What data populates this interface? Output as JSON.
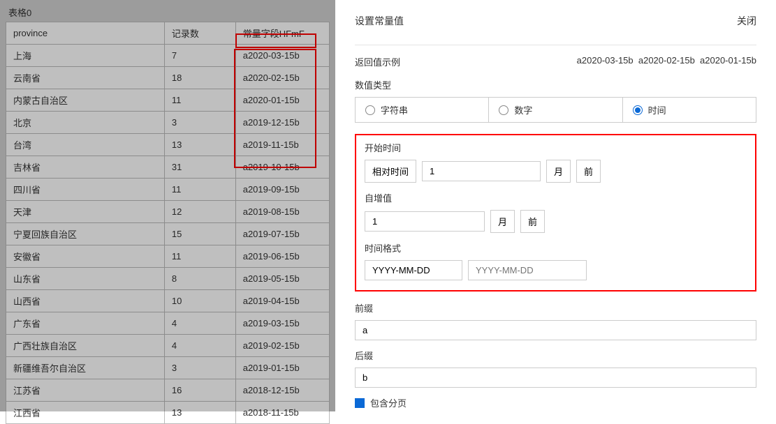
{
  "left": {
    "title": "表格0",
    "headers": [
      "province",
      "记录数",
      "常量字段HFmF"
    ],
    "rows": [
      {
        "c0": "上海",
        "c1": "7",
        "c2": "a2020-03-15b"
      },
      {
        "c0": "云南省",
        "c1": "18",
        "c2": "a2020-02-15b"
      },
      {
        "c0": "内蒙古自治区",
        "c1": "11",
        "c2": "a2020-01-15b"
      },
      {
        "c0": "北京",
        "c1": "3",
        "c2": "a2019-12-15b"
      },
      {
        "c0": "台湾",
        "c1": "13",
        "c2": "a2019-11-15b"
      },
      {
        "c0": "吉林省",
        "c1": "31",
        "c2": "a2019-10-15b"
      },
      {
        "c0": "四川省",
        "c1": "11",
        "c2": "a2019-09-15b"
      },
      {
        "c0": "天津",
        "c1": "12",
        "c2": "a2019-08-15b"
      },
      {
        "c0": "宁夏回族自治区",
        "c1": "15",
        "c2": "a2019-07-15b"
      },
      {
        "c0": "安徽省",
        "c1": "11",
        "c2": "a2019-06-15b"
      },
      {
        "c0": "山东省",
        "c1": "8",
        "c2": "a2019-05-15b"
      },
      {
        "c0": "山西省",
        "c1": "10",
        "c2": "a2019-04-15b"
      },
      {
        "c0": "广东省",
        "c1": "4",
        "c2": "a2019-03-15b"
      },
      {
        "c0": "广西壮族自治区",
        "c1": "4",
        "c2": "a2019-02-15b"
      },
      {
        "c0": "新疆维吾尔自治区",
        "c1": "3",
        "c2": "a2019-01-15b"
      },
      {
        "c0": "江苏省",
        "c1": "16",
        "c2": "a2018-12-15b"
      },
      {
        "c0": "江西省",
        "c1": "13",
        "c2": "a2018-11-15b"
      }
    ]
  },
  "right": {
    "title": "设置常量值",
    "close": "关闭",
    "example_label": "返回值示例",
    "example_value": "a2020-03-15b  a2020-02-15b  a2020-01-15b",
    "type_label": "数值类型",
    "type_options": {
      "string": "字符串",
      "number": "数字",
      "time": "时间"
    },
    "start_label": "开始时间",
    "relative_time_btn": "相对时间",
    "start_value": "1",
    "unit_month": "月",
    "dir_before": "前",
    "increment_label": "自增值",
    "increment_value": "1",
    "format_label": "时间格式",
    "format1": "YYYY-MM-DD",
    "format2_placeholder": "YYYY-MM-DD",
    "prefix_label": "前缀",
    "prefix_value": "a",
    "suffix_label": "后缀",
    "suffix_value": "b",
    "pagination_label": "包含分页"
  }
}
